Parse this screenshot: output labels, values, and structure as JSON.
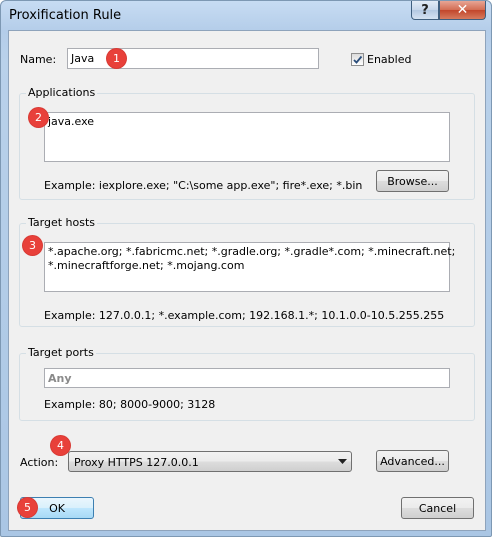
{
  "window": {
    "title": "Proxification Rule",
    "help_label": "?",
    "close_label": "✕"
  },
  "name": {
    "label": "Name:",
    "value": "Java"
  },
  "enabled": {
    "label": "Enabled",
    "checked": true,
    "checkmark": "✓"
  },
  "applications": {
    "title": "Applications",
    "value": "java.exe",
    "example": "Example: iexplore.exe; \"C:\\some app.exe\"; fire*.exe; *.bin",
    "browse_label": "Browse..."
  },
  "target_hosts": {
    "title": "Target hosts",
    "line1": "*.apache.org; *.fabricmc.net; *.gradle.org; *.gradle*.com; *.minecraft.net;",
    "line2": "*.minecraftforge.net; *.mojang.com",
    "example": "Example: 127.0.0.1; *.example.com; 192.168.1.*; 10.1.0.0-10.5.255.255"
  },
  "target_ports": {
    "title": "Target ports",
    "placeholder": "Any",
    "example": "Example: 80; 8000-9000; 3128"
  },
  "action": {
    "label": "Action:",
    "value": "Proxy HTTPS 127.0.0.1",
    "advanced_label": "Advanced..."
  },
  "footer": {
    "ok_label": "OK",
    "cancel_label": "Cancel"
  },
  "badges": [
    "1",
    "2",
    "3",
    "4",
    "5"
  ],
  "colors": {
    "badge": "#e8403a",
    "titlebar": "#b9d1ea",
    "close": "#c2462b"
  },
  "icons": {
    "dropdown": "chevron-down-icon",
    "checkbox": "check-icon"
  }
}
